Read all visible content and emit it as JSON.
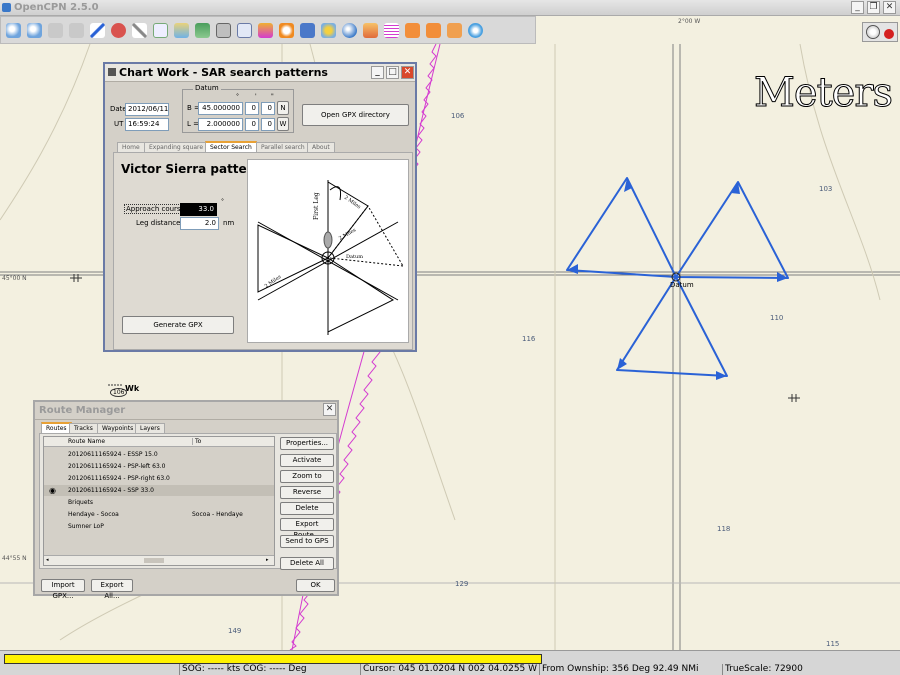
{
  "app": {
    "title": "OpenCPN 2.5.0"
  },
  "chart": {
    "scale_label": "Meters",
    "depths": [
      "106",
      "103",
      "110",
      "116",
      "118",
      "129",
      "149",
      "115"
    ],
    "latlabels": [
      "45°00 N",
      "44°55 N"
    ],
    "lonlabel": "2°00 W",
    "datum_label": "Datum",
    "wreck_label": "Wk",
    "wreck_depth": "106"
  },
  "sar": {
    "title": "Chart Work - SAR search patterns",
    "datum_label": "Datum",
    "date_label": "Date",
    "date": "2012/06/11",
    "ut_label": "UT",
    "ut": "16:59:24",
    "deg_sym": "°",
    "min_sym": "'",
    "sec_sym": "\"",
    "b_label": "B =",
    "b_deg": "45.000000",
    "b_min": "0",
    "b_sec": "0",
    "b_hemi": "N",
    "l_label": "L =",
    "l_deg": "2.000000",
    "l_min": "0",
    "l_sec": "0",
    "l_hemi": "W",
    "open_gpx_button": "Open GPX directory",
    "tabs": [
      "Home",
      "Expanding square",
      "Sector Search",
      "Parallel search",
      "About"
    ],
    "pattern_title": "Victor Sierra pattern",
    "approach_label": "Approach course =",
    "approach_value": "33.0",
    "deg_unit": "°",
    "leg_label": "Leg distance =",
    "leg_value": "2.0",
    "leg_unit": "nm",
    "generate_button": "Generate GPX",
    "diagram": {
      "first_leg": "First Leg",
      "miles": "2 Miles",
      "datum": "Datum"
    }
  },
  "route_manager": {
    "title": "Route Manager",
    "tabs": [
      "Routes",
      "Tracks",
      "Waypoints",
      "Layers"
    ],
    "columns": [
      "Route Name",
      "To"
    ],
    "rows": [
      {
        "name": "20120611165924 - ESSP 15.0",
        "to": ""
      },
      {
        "name": "20120611165924 - PSP-left 63.0",
        "to": ""
      },
      {
        "name": "20120611165924 - PSP-right 63.0",
        "to": ""
      },
      {
        "name": "20120611165924 - SSP 33.0",
        "to": ""
      },
      {
        "name": "Briquets",
        "to": ""
      },
      {
        "name": "Hendaye - Socoa",
        "to": "Socoa - Hendaye"
      },
      {
        "name": "Sumner LoP",
        "to": ""
      }
    ],
    "buttons": [
      "Properties...",
      "Activate",
      "Zoom to",
      "Reverse",
      "Delete",
      "Export Route...",
      "Send to GPS",
      "Delete All"
    ],
    "import_button": "Import GPX...",
    "export_all_button": "Export All...",
    "ok_button": "OK"
  },
  "status": {
    "sog_cog": "SOG: ----- kts  COG: ----- Deg",
    "cursor": "Cursor: 045 01.0204 N 002 04.0255 W",
    "from_ownship": "From Ownship: 356 Deg   92.49 NMi",
    "truescale": "TrueScale:     72900"
  },
  "colors": {
    "chart_bg": "#f3f0e0",
    "route_blue": "#2a62d6",
    "boundary_magenta": "#d43bd0",
    "progress_yellow": "#fff200",
    "dialog_bg": "#d4d0c8"
  }
}
